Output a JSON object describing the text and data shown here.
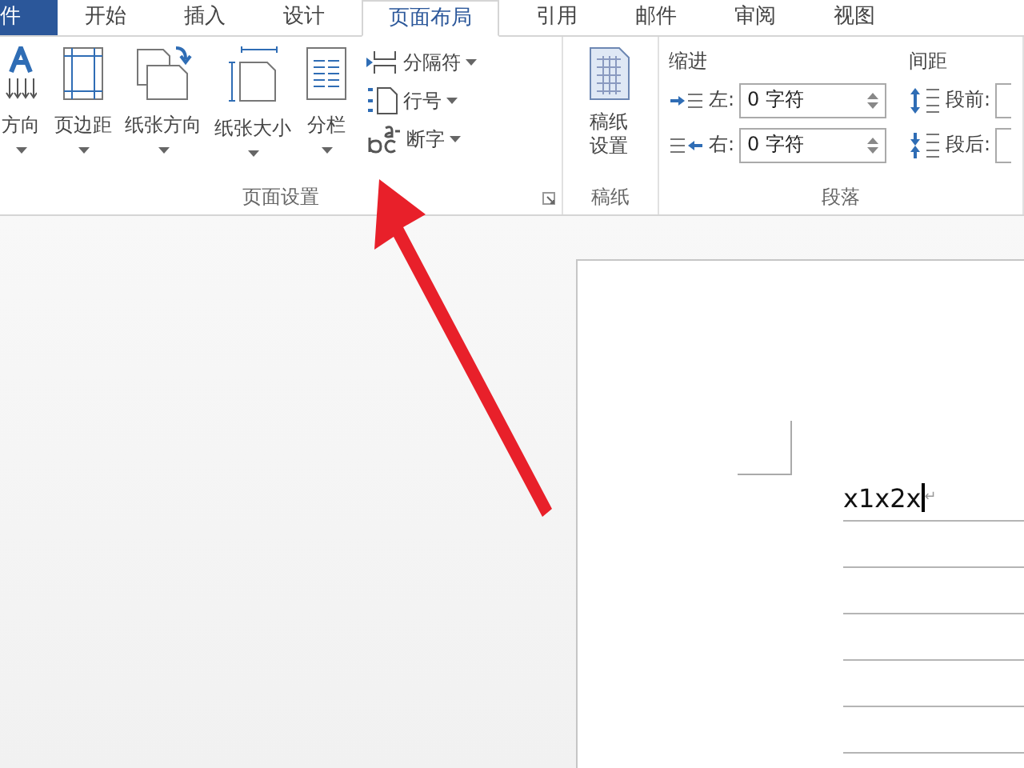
{
  "tabs": [
    {
      "label": "件",
      "kind": "file",
      "selected": false
    },
    {
      "label": "开始",
      "kind": "tab",
      "selected": false
    },
    {
      "label": "插入",
      "kind": "tab",
      "selected": false
    },
    {
      "label": "设计",
      "kind": "tab",
      "selected": false
    },
    {
      "label": "页面布局",
      "kind": "tab",
      "selected": true
    },
    {
      "label": "引用",
      "kind": "tab",
      "selected": false
    },
    {
      "label": "邮件",
      "kind": "tab",
      "selected": false
    },
    {
      "label": "审阅",
      "kind": "tab",
      "selected": false
    },
    {
      "label": "视图",
      "kind": "tab",
      "selected": false
    }
  ],
  "page_setup": {
    "label": "页面设置",
    "large_buttons": [
      {
        "label": "方向"
      },
      {
        "label": "页边距"
      },
      {
        "label": "纸张方向"
      },
      {
        "label": "纸张大小"
      },
      {
        "label": "分栏"
      }
    ],
    "small_buttons": [
      {
        "label": "分隔符"
      },
      {
        "label": "行号"
      },
      {
        "label": "断字"
      }
    ]
  },
  "manuscript": {
    "label": "稿纸",
    "button": "稿纸设置"
  },
  "paragraph": {
    "label": "段落",
    "indent": {
      "heading": "缩进",
      "fields": [
        {
          "label": "左:",
          "value": "0 字符"
        },
        {
          "label": "右:",
          "value": "0 字符"
        }
      ]
    },
    "spacing": {
      "heading": "间距",
      "fields": [
        {
          "label": "段前:"
        },
        {
          "label": "段后:"
        }
      ]
    }
  },
  "document": {
    "text": "x1x2x",
    "paragraph_mark": "↵"
  }
}
